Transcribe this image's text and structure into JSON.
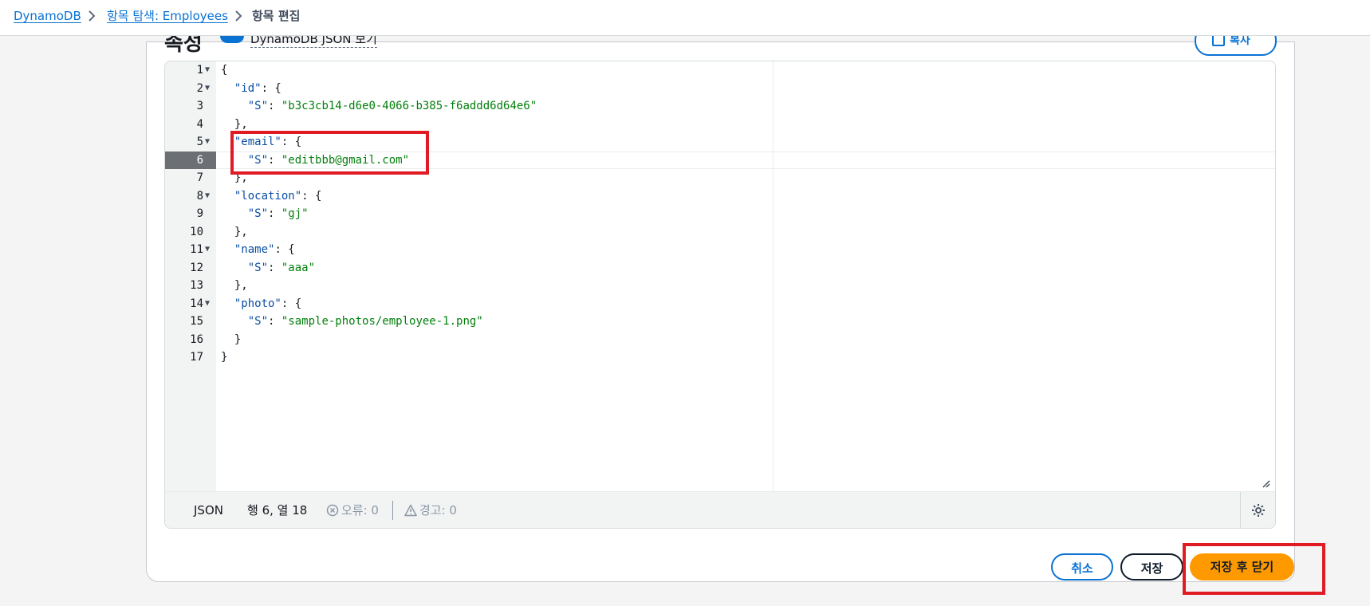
{
  "breadcrumb": {
    "items": [
      "DynamoDB",
      "항목 탐색: Employees",
      "항목 편집"
    ]
  },
  "section": {
    "title_partial": "속성",
    "view_toggle_label": "DynamoDB JSON 보기",
    "copy_button_label": "복사"
  },
  "editor": {
    "lines": [
      {
        "n": "1",
        "fold": true
      },
      {
        "n": "2",
        "fold": true
      },
      {
        "n": "3",
        "fold": false
      },
      {
        "n": "4",
        "fold": false
      },
      {
        "n": "5",
        "fold": true
      },
      {
        "n": "6",
        "fold": false,
        "active": true
      },
      {
        "n": "7",
        "fold": false
      },
      {
        "n": "8",
        "fold": true
      },
      {
        "n": "9",
        "fold": false
      },
      {
        "n": "10",
        "fold": false
      },
      {
        "n": "11",
        "fold": true
      },
      {
        "n": "12",
        "fold": false
      },
      {
        "n": "13",
        "fold": false
      },
      {
        "n": "14",
        "fold": true
      },
      {
        "n": "15",
        "fold": false
      },
      {
        "n": "16",
        "fold": false
      },
      {
        "n": "17",
        "fold": false
      }
    ],
    "code": [
      "{",
      "  \"id\": {",
      "    \"S\": \"b3c3cb14-d6e0-4066-b385-f6addd6d64e6\"",
      "  },",
      "  \"email\": {",
      "    \"S\": \"editbbb@gmail.com\"",
      "  },",
      "  \"location\": {",
      "    \"S\": \"gj\"",
      "  },",
      "  \"name\": {",
      "    \"S\": \"aaa\"",
      "  },",
      "  \"photo\": {",
      "    \"S\": \"sample-photos/employee-1.png\"",
      "  }",
      "}"
    ]
  },
  "status": {
    "language": "JSON",
    "cursor": "행 6, 열 18",
    "errors": "오류: 0",
    "warnings": "경고: 0"
  },
  "actions": {
    "cancel": "취소",
    "save": "저장",
    "save_close": "저장 후 닫기"
  },
  "colors": {
    "link": "#0972d3",
    "primary_button": "#ff9900",
    "highlight": "#e01b24",
    "json_key": "#0b4ea2",
    "json_string": "#037f0c"
  }
}
